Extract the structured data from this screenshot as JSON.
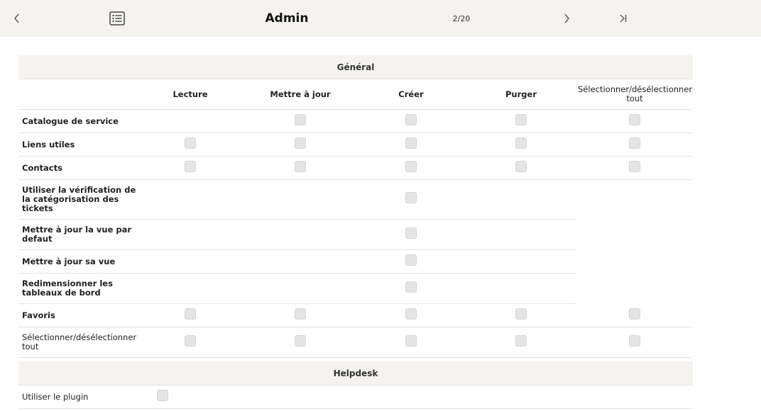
{
  "header": {
    "title": "Admin",
    "pager": "2/20"
  },
  "sections": {
    "general": "Général",
    "helpdesk": "Helpdesk"
  },
  "columns": {
    "read": "Lecture",
    "update": "Mettre à jour",
    "create": "Créer",
    "purge": "Purger",
    "select_all": "Sélectionner/désélectionner tout"
  },
  "rows": [
    {
      "label": "Catalogue de service"
    },
    {
      "label": "Liens utiles"
    },
    {
      "label": "Contacts"
    },
    {
      "label": "Utiliser la vérification de la catégorisation des tickets"
    },
    {
      "label": "Mettre à jour la vue par defaut"
    },
    {
      "label": "Mettre à jour sa vue"
    },
    {
      "label": "Redimensionner les tableaux de bord"
    },
    {
      "label": "Favoris"
    },
    {
      "label": "Sélectionner/désélectionner tout"
    }
  ],
  "helpdesk_rows": [
    {
      "label": "Utiliser le plugin"
    }
  ]
}
